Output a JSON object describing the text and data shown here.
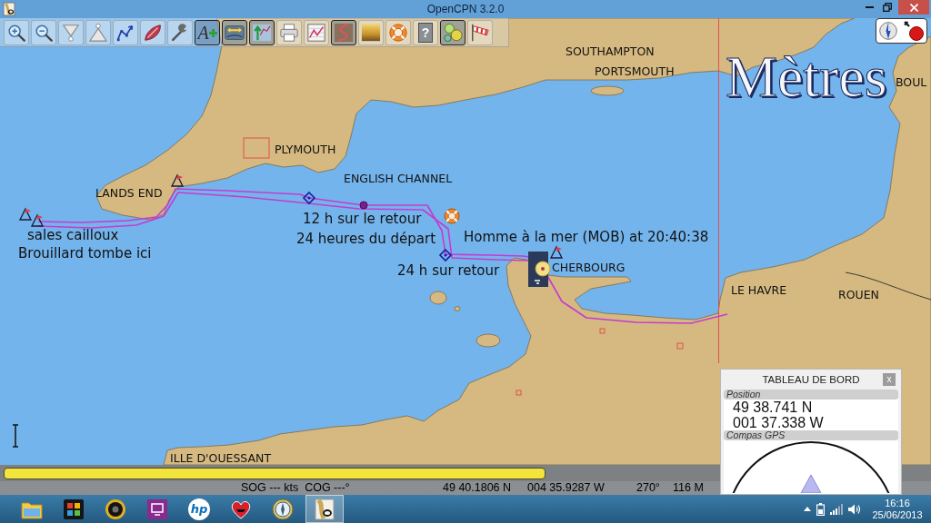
{
  "window": {
    "title": "OpenCPN 3.2.0"
  },
  "toolbar": [
    {
      "kind": "zoom-in",
      "selected": false
    },
    {
      "kind": "zoom-out",
      "selected": false
    },
    {
      "kind": "scale-down",
      "selected": false
    },
    {
      "kind": "scale-up",
      "selected": false
    },
    {
      "kind": "route",
      "selected": false
    },
    {
      "kind": "boat",
      "selected": false
    },
    {
      "kind": "tools",
      "selected": false
    },
    {
      "kind": "text",
      "glyph": "A",
      "selected": true
    },
    {
      "kind": "quilt",
      "selected": true
    },
    {
      "kind": "tides",
      "selected": true
    },
    {
      "kind": "print",
      "selected": false
    },
    {
      "kind": "route-manager",
      "selected": false
    },
    {
      "kind": "track",
      "selected": true
    },
    {
      "kind": "sunset",
      "selected": false
    },
    {
      "kind": "mob",
      "selected": false
    },
    {
      "kind": "help",
      "glyph": "?",
      "selected": false
    },
    {
      "kind": "dashboard",
      "selected": true
    },
    {
      "kind": "windsock",
      "selected": false
    }
  ],
  "chart": {
    "depth_units": "Mètres",
    "place_labels": [
      "SOUTHAMPTON",
      "PORTSMOUTH",
      "PLYMOUTH",
      "ENGLISH CHANNEL",
      "LANDS END",
      "CHERBOURG",
      "LE HAVRE",
      "ROUEN",
      "BOUL",
      "ILLE D'OUESSANT"
    ],
    "waypoints": [
      {
        "label": "sales cailloux",
        "kind": "triangle"
      },
      {
        "label": "Brouillard tombe ici",
        "kind": "triangle"
      },
      {
        "label": "12 h sur le retour",
        "kind": "diamond"
      },
      {
        "label": "24 heures du départ",
        "kind": "dot"
      },
      {
        "label": "24 h sur retour",
        "kind": "diamond"
      }
    ],
    "mob": {
      "label": "Homme à la mer (MOB) at 20:40:38"
    }
  },
  "dashboard": {
    "title": "TABLEAU DE BORD",
    "close": "x",
    "sections": [
      {
        "kind": "text",
        "title": "Position",
        "lines": [
          "49 38.741 N",
          "001 37.338 W"
        ]
      },
      {
        "kind": "compass",
        "title": "Compas GPS"
      }
    ]
  },
  "status_bar": {
    "fields": [
      "SOG --- kts  COG ---°",
      "49 40.1806 N",
      "004 35.9287 W",
      "270°",
      "116 M"
    ]
  },
  "taskbar": {
    "apps": [
      {
        "kind": "folder",
        "selected": false
      },
      {
        "kind": "puzzle",
        "selected": false
      },
      {
        "kind": "webcam",
        "selected": false
      },
      {
        "kind": "screen",
        "selected": false
      },
      {
        "kind": "logo",
        "text": "hp",
        "selected": false
      },
      {
        "kind": "heart",
        "selected": false
      },
      {
        "kind": "compass",
        "selected": false
      },
      {
        "kind": "map",
        "selected": true
      }
    ],
    "time": "16:16",
    "date": "25/06/2013"
  }
}
